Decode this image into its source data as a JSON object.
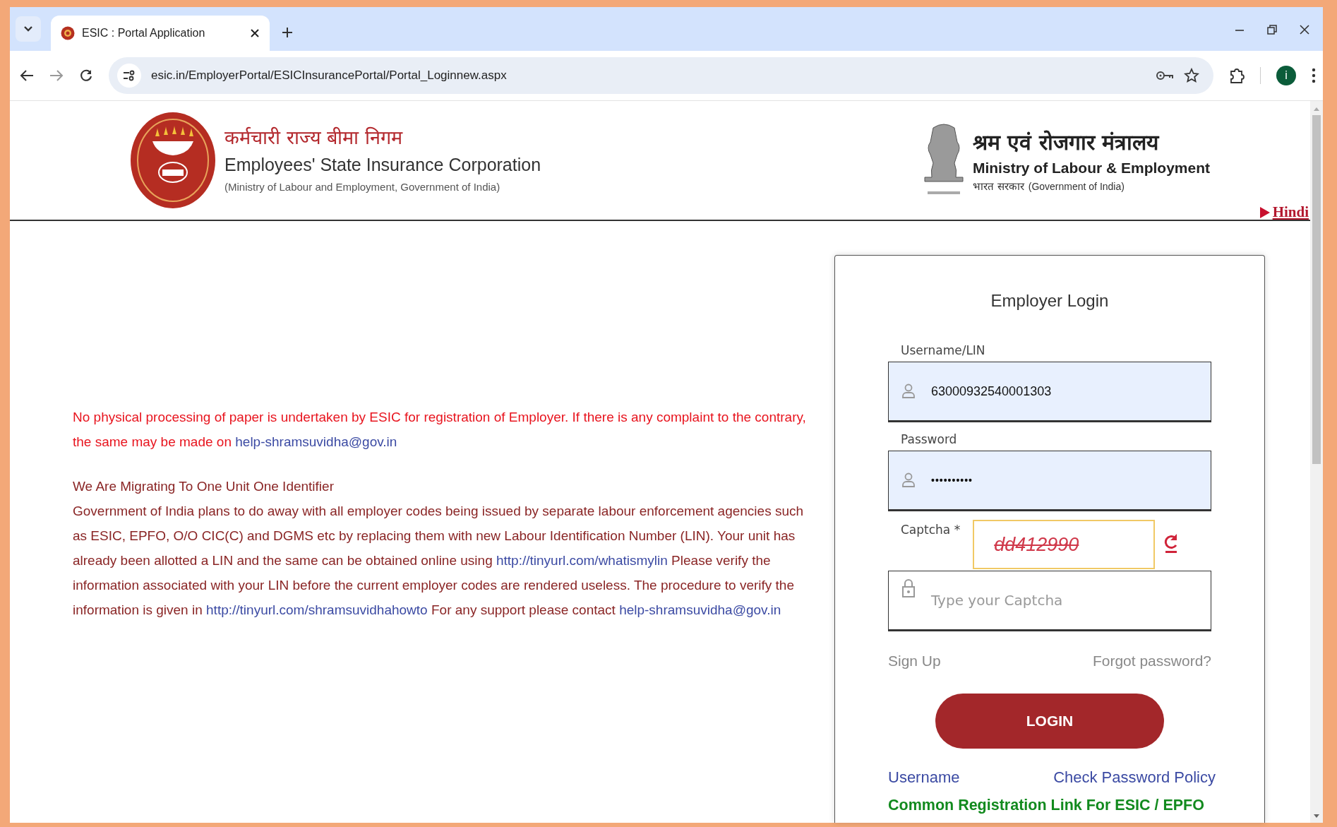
{
  "browser": {
    "tab": {
      "title": "ESIC : Portal Application",
      "selected": true
    },
    "address": "esic.in/EmployerPortal/ESICInsurancePortal/Portal_Loginnew.aspx",
    "profile_initial": "i"
  },
  "header": {
    "org_hindi": "कर्मचारी राज्य बीमा निगम",
    "org_english": "Employees' State Insurance Corporation",
    "org_sub": "(Ministry of Labour and Employment, Government of India)",
    "ministry_hindi": "श्रम एवं रोजगार मंत्रालय",
    "ministry_english": "Ministry of Labour & Employment",
    "govt_hindi": "भारत सरकार",
    "govt_english": "(Government of India)",
    "language_link": "Hindi"
  },
  "notice": [
    {
      "kind": "alert",
      "segments": [
        {
          "kind": "text",
          "text": "No physical processing of paper is undertaken by ESIC for registration of Employer. If there is any complaint to the contrary, the same may be made on "
        },
        {
          "kind": "link",
          "text": "help-shramsuvidha@gov.in"
        }
      ]
    },
    {
      "kind": "heading",
      "segments": [
        {
          "kind": "text",
          "text": "We Are Migrating To One Unit One Identifier"
        }
      ]
    },
    {
      "kind": "body",
      "segments": [
        {
          "kind": "text",
          "text": "Government of India plans to do away with all employer codes being issued by separate labour enforcement agencies such as ESIC, EPFO, O/O CIC(C) and DGMS etc by replacing them with new Labour Identification Number (LIN). Your unit has already been allotted a LIN and the same can be obtained online using "
        },
        {
          "kind": "link",
          "text": "http://tinyurl.com/whatismylin"
        },
        {
          "kind": "text",
          "text": " Please verify the information associated with your LIN before the current employer codes are rendered useless. The procedure to verify the information is given in "
        },
        {
          "kind": "link",
          "text": "http://tinyurl.com/shramsuvidhahowto"
        },
        {
          "kind": "text",
          "text": " For any support please contact "
        },
        {
          "kind": "link",
          "text": "help-shramsuvidha@gov.in"
        }
      ]
    }
  ],
  "login": {
    "title": "Employer Login",
    "fields": [
      {
        "kind": "user",
        "label": "Username/LIN",
        "value": "63000932540001303"
      },
      {
        "kind": "password",
        "label": "Password",
        "value": "••••••••••"
      }
    ],
    "captcha": {
      "label": "Captcha *",
      "code": "dd412990",
      "placeholder": "Type your Captcha"
    },
    "links": [
      "Sign Up",
      "Forgot password?"
    ],
    "button": "LOGIN",
    "bottom_links": [
      "Username",
      "Check Password Policy"
    ],
    "registration_link": "Common Registration Link For ESIC / EPFO"
  }
}
